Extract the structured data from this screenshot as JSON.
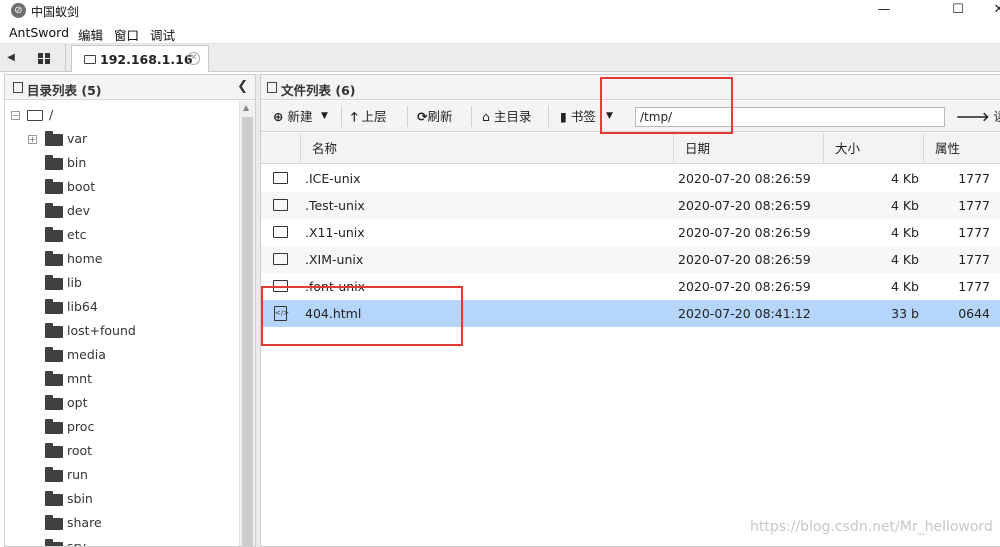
{
  "window": {
    "title": "中国蚁剑",
    "controls": [
      "—",
      "☐",
      "✕"
    ]
  },
  "menu": [
    "AntSword",
    "编辑",
    "窗口",
    "调试"
  ],
  "tabs": {
    "active_label": "192.168.1.16"
  },
  "left_panel": {
    "title": "目录列表 (5)",
    "root": "/",
    "dirs": [
      "var",
      "bin",
      "boot",
      "dev",
      "etc",
      "home",
      "lib",
      "lib64",
      "lost+found",
      "media",
      "mnt",
      "opt",
      "proc",
      "root",
      "run",
      "sbin",
      "share",
      "srv"
    ]
  },
  "right_panel": {
    "title": "文件列表 (6)",
    "toolbar": {
      "new": "新建",
      "up": "上层",
      "refresh": "刷新",
      "home": "主目录",
      "bookmark": "书签",
      "path_value": "/tmp/",
      "read": "读取"
    },
    "columns": {
      "name": "名称",
      "date": "日期",
      "size": "大小",
      "attr": "属性"
    },
    "rows": [
      {
        "name": ".ICE-unix",
        "date": "2020-07-20 08:26:59",
        "size": "4 Kb",
        "attr": "1777",
        "type": "folder"
      },
      {
        "name": ".Test-unix",
        "date": "2020-07-20 08:26:59",
        "size": "4 Kb",
        "attr": "1777",
        "type": "folder"
      },
      {
        "name": ".X11-unix",
        "date": "2020-07-20 08:26:59",
        "size": "4 Kb",
        "attr": "1777",
        "type": "folder"
      },
      {
        "name": ".XIM-unix",
        "date": "2020-07-20 08:26:59",
        "size": "4 Kb",
        "attr": "1777",
        "type": "folder"
      },
      {
        "name": ".font-unix",
        "date": "2020-07-20 08:26:59",
        "size": "4 Kb",
        "attr": "1777",
        "type": "folder"
      },
      {
        "name": "404.html",
        "date": "2020-07-20 08:41:12",
        "size": "33 b",
        "attr": "0644",
        "type": "file"
      }
    ]
  },
  "watermark": "https://blog.csdn.net/Mr_helloword",
  "colors": {
    "selected_row": "#b5d5fa",
    "highlight_box": "#e53935"
  }
}
